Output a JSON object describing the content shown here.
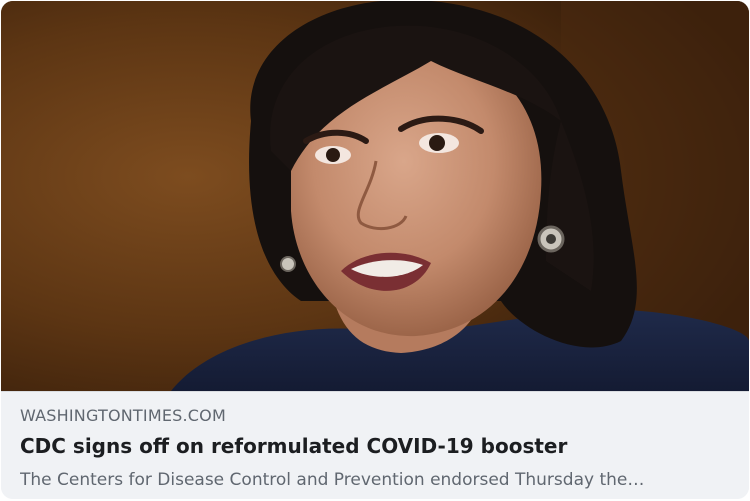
{
  "link_preview": {
    "image_alt": "Woman with dark shoulder-length hair speaking, wearing earrings and a navy top",
    "domain": "WASHINGTONTIMES.COM",
    "title": "CDC signs off on reformulated COVID-19 booster",
    "description": "The Centers for Disease Control and Prevention endorsed Thursday the…"
  },
  "colors": {
    "card_background": "#f0f2f5",
    "title_text": "#1c1e21",
    "secondary_text": "#606770"
  }
}
